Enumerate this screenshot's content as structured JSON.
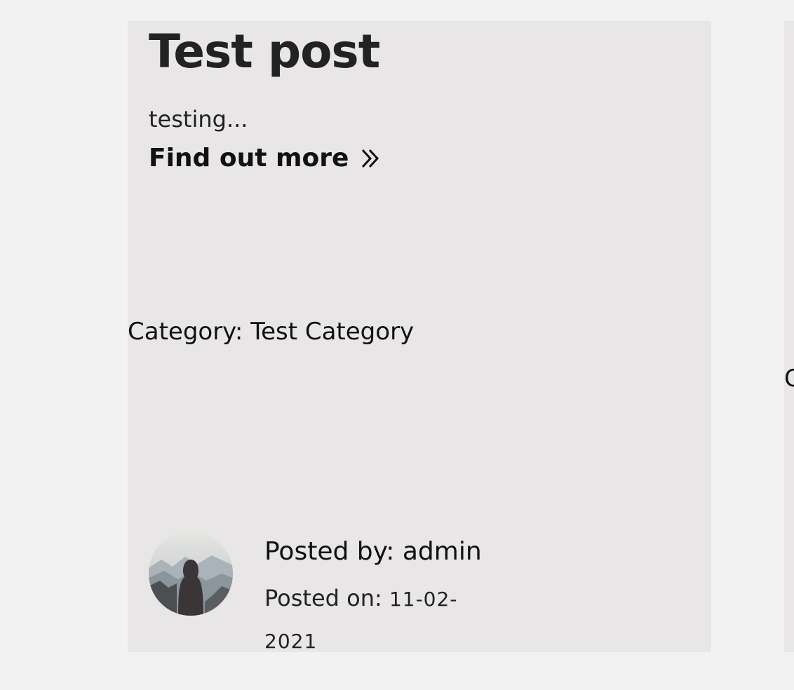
{
  "post": {
    "title": "Test post",
    "excerpt": "testing...",
    "find_more_label": "Find out more",
    "find_more_icon": "double-chevron-right-icon",
    "category_label": "Category: Test Category",
    "author_label": "Posted by: admin",
    "posted_on_label": "Posted on: ",
    "posted_on_date": "11-02-2021",
    "avatar_icon": "hooded-figure-mountains-avatar"
  },
  "next_card": {
    "peek_text": "C"
  },
  "colors": {
    "page_background": "#f2f2f2",
    "card_background": "#e8e6e7",
    "text": "#1c1c1c"
  }
}
